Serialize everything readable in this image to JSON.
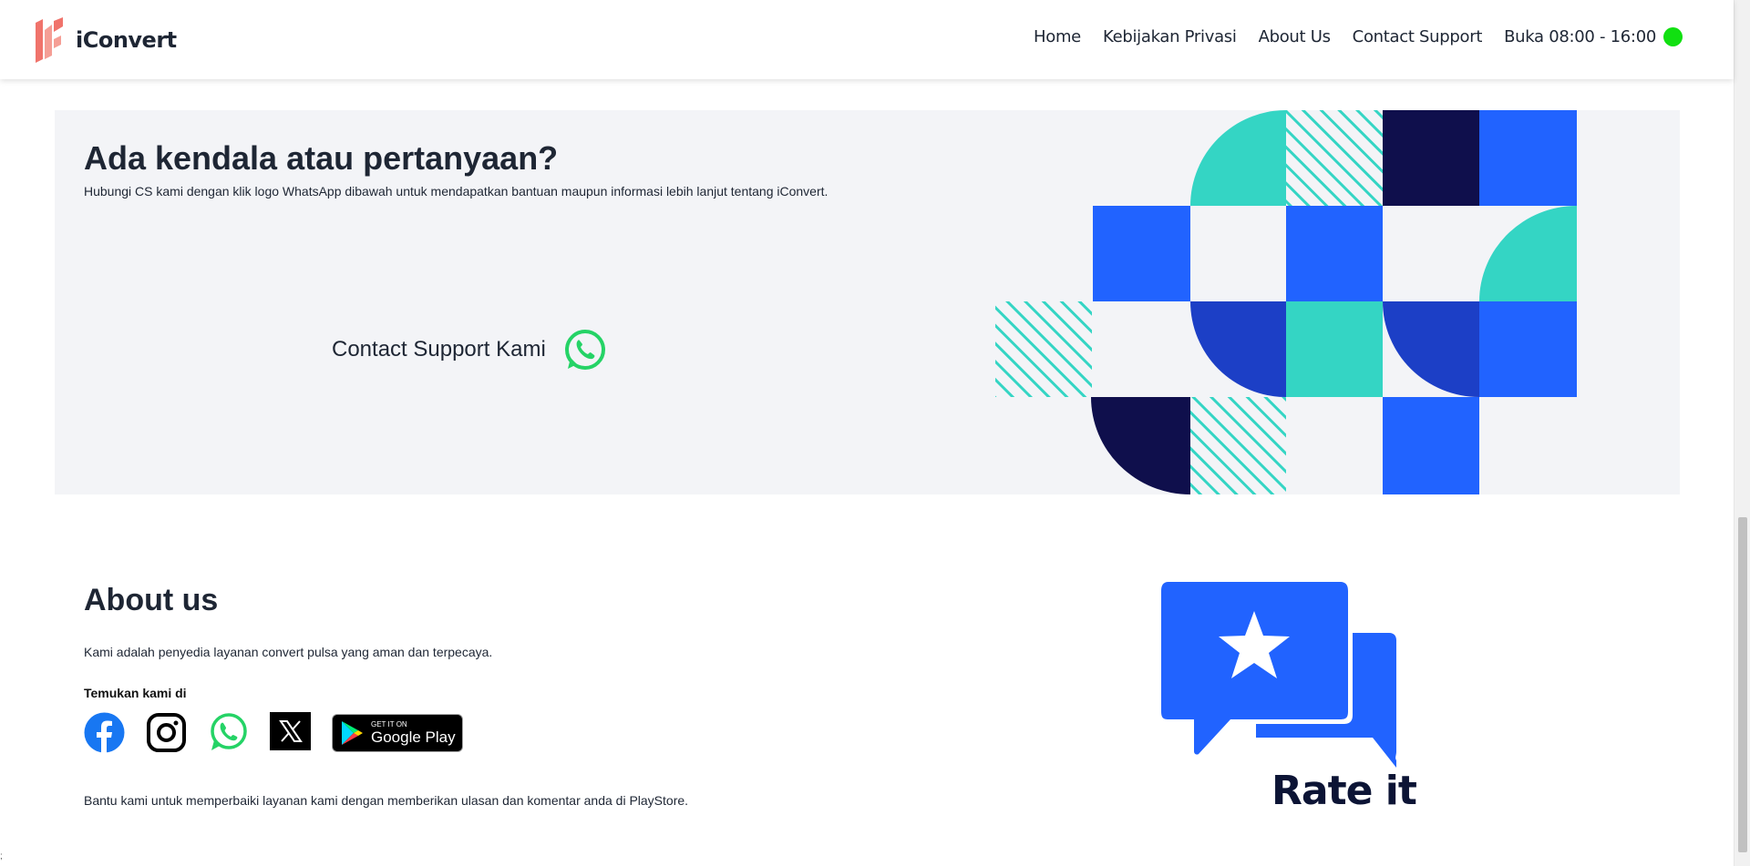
{
  "header": {
    "brand": "iConvert",
    "nav": [
      "Home",
      "Kebijakan Privasi",
      "About Us",
      "Contact Support"
    ],
    "hours": "Buka 08:00 - 16:00",
    "status_color": "#11e011"
  },
  "contact": {
    "title": "Ada kendala atau pertanyaan?",
    "subtitle": "Hubungi CS kami dengan klik logo WhatsApp dibawah untuk mendapatkan bantuan maupun informasi lebih lanjut tentang iConvert.",
    "button_label": "Contact Support Kami",
    "button_icon": "whatsapp-icon"
  },
  "about": {
    "title": "About us",
    "text": "Kami adalah penyedia layanan convert pulsa yang aman dan terpecaya.",
    "find_label": "Temukan kami di",
    "socials": [
      "facebook-icon",
      "instagram-icon",
      "whatsapp-icon",
      "x-icon",
      "google-play-badge"
    ],
    "gplay_small": "GET IT ON",
    "gplay_big": "Google Play",
    "review_text": "Bantu kami untuk memperbaiki layanan kami dengan memberikan ulasan dan komentar anda di PlayStore."
  },
  "rate": {
    "label": "Rate it"
  },
  "colors": {
    "blue": "#2163ff",
    "teal": "#34d5c4",
    "navy": "#0f0f4c",
    "indigo": "#1c3fc6",
    "panel_bg": "#f3f4f7",
    "brand_red": "#f0736b"
  },
  "corner_mark": ";"
}
